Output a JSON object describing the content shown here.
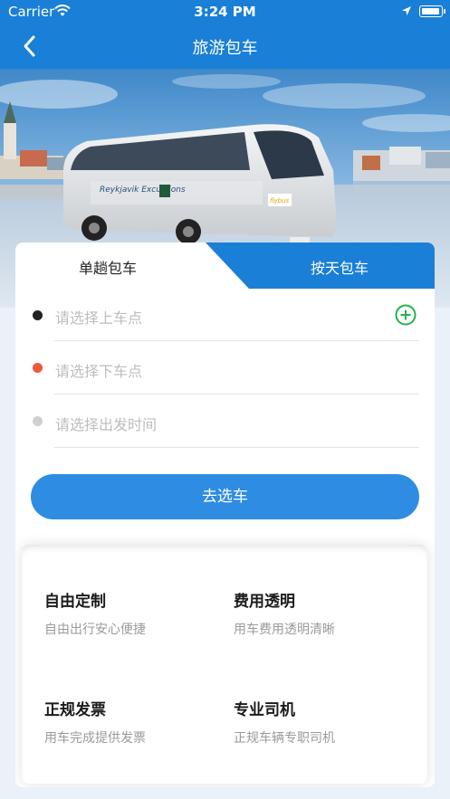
{
  "status_bar": {
    "carrier": "Carrier",
    "time": "3:24 PM"
  },
  "nav": {
    "title": "旅游包车"
  },
  "banner": {
    "bus_brand": "Reykjavik Excursions",
    "bus_sub": "flybus"
  },
  "tabs": {
    "single": "单趟包车",
    "daily": "按天包车"
  },
  "form": {
    "pickup_placeholder": "请选择上车点",
    "dropoff_placeholder": "请选择下车点",
    "time_placeholder": "请选择出发时间",
    "submit_label": "去选车"
  },
  "features": [
    {
      "title": "自由定制",
      "desc": "自由出行安心便捷"
    },
    {
      "title": "费用透明",
      "desc": "用车费用透明清晰"
    },
    {
      "title": "正规发票",
      "desc": "用车完成提供发票"
    },
    {
      "title": "专业司机",
      "desc": "正规车辆专职司机"
    }
  ],
  "colors": {
    "primary": "#1a7fd6",
    "button": "#2e8ce3",
    "add_icon": "#23b24b",
    "dropoff_dot": "#f0583a"
  }
}
